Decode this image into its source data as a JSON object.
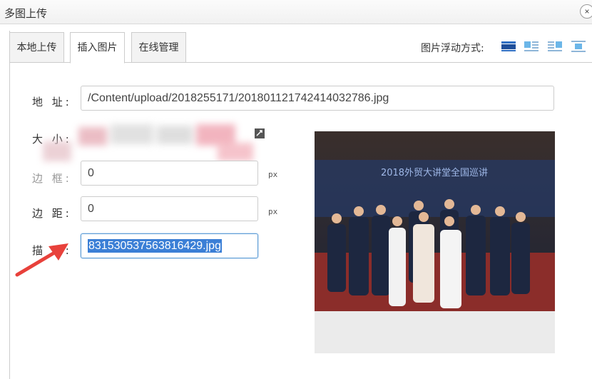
{
  "dialog": {
    "title": "多图上传",
    "close_icon": "×"
  },
  "tabs": [
    {
      "label": "本地上传",
      "active": false
    },
    {
      "label": "插入图片",
      "active": true
    },
    {
      "label": "在线管理",
      "active": false
    }
  ],
  "float": {
    "label": "图片浮动方式:",
    "options": [
      "none",
      "left",
      "right",
      "center"
    ]
  },
  "form": {
    "address": {
      "label": "地 址:",
      "value": "/Content/upload/2018255171/20180112174241403278​6.jpg"
    },
    "size": {
      "label": "大 小:"
    },
    "border": {
      "label": "边 框:",
      "value": "0",
      "unit": "px"
    },
    "margin": {
      "label": "边 距:",
      "value": "0",
      "unit": "px"
    },
    "description": {
      "label": "描 述:",
      "value": "831530537563816429.jpg"
    }
  },
  "preview": {
    "banner_text": "2018外贸大讲堂全国巡讲",
    "alt": "group photo"
  },
  "colors": {
    "selection": "#3b7fd6",
    "focus_border": "#5b9bd5",
    "arrow": "#e8413b"
  }
}
